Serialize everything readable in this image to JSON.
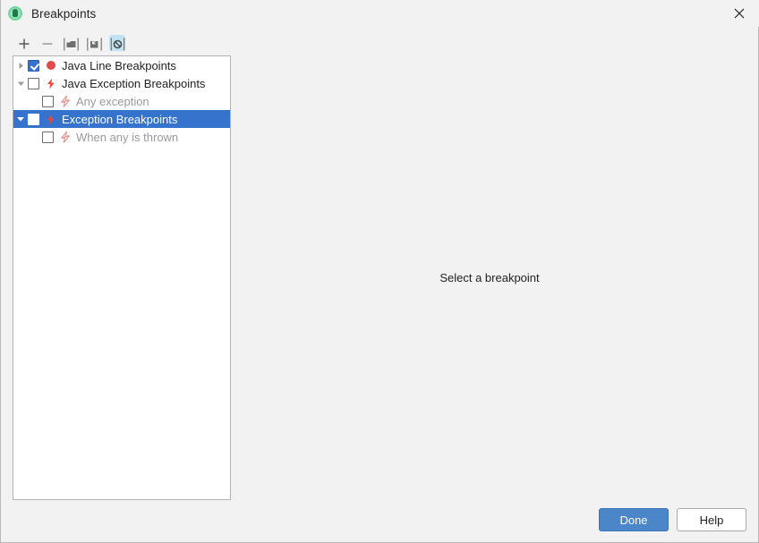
{
  "window": {
    "title": "Breakpoints",
    "app_icon": "intellij-idea-icon",
    "close_icon": "close-icon"
  },
  "toolbar": {
    "buttons": [
      {
        "name": "add-breakpoint-button",
        "icon": "plus-icon",
        "label": "Add",
        "active": false
      },
      {
        "name": "remove-breakpoint-button",
        "icon": "minus-icon",
        "label": "Remove",
        "active": false
      },
      {
        "name": "import-breakpoints-button",
        "icon": "folder-open-icon",
        "label": "Import",
        "active": false
      },
      {
        "name": "export-breakpoints-button",
        "icon": "save-disk-icon",
        "label": "Export",
        "active": false
      },
      {
        "name": "mute-breakpoints-button",
        "icon": "mute-breakpoints-icon",
        "label": "Mute Breakpoints",
        "active": true
      }
    ]
  },
  "tree": {
    "items": [
      {
        "label": "Java Line Breakpoints",
        "name": "tree-item-java-line-breakpoints",
        "depth": 0,
        "twisty": "collapsed",
        "checked": true,
        "icon": "red-dot-breakpoint-icon",
        "muted": false,
        "selected": false
      },
      {
        "label": "Java Exception Breakpoints",
        "name": "tree-item-java-exception-breakpoints",
        "depth": 0,
        "twisty": "expanded",
        "checked": false,
        "icon": "lightning-breakpoint-icon",
        "muted": false,
        "selected": false
      },
      {
        "label": "Any exception",
        "name": "tree-item-any-exception",
        "depth": 1,
        "twisty": "none",
        "checked": false,
        "icon": "lightning-breakpoint-muted-icon",
        "muted": true,
        "selected": false
      },
      {
        "label": "Exception Breakpoints",
        "name": "tree-item-exception-breakpoints",
        "depth": 0,
        "twisty": "expanded",
        "checked": false,
        "icon": "lightning-breakpoint-icon",
        "muted": false,
        "selected": true
      },
      {
        "label": "When any is thrown",
        "name": "tree-item-when-any-is-thrown",
        "depth": 1,
        "twisty": "none",
        "checked": false,
        "icon": "lightning-breakpoint-muted-icon",
        "muted": true,
        "selected": false
      }
    ]
  },
  "detail": {
    "empty_message": "Select a breakpoint"
  },
  "footer": {
    "done_label": "Done",
    "help_label": "Help"
  },
  "colors": {
    "selection_blue": "#3573cc",
    "primary_button": "#4a86c8",
    "breakpoint_red": "#e04a4a",
    "muted_text": "#9a9a9a",
    "window_bg": "#f2f2f2",
    "toggle_highlight": "#bfe3f5"
  }
}
